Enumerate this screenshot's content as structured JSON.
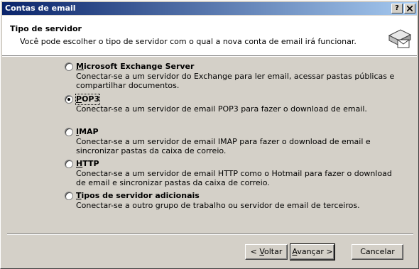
{
  "window": {
    "title": "Contas de email",
    "help_button": "?",
    "close_button": "X"
  },
  "header": {
    "title": "Tipo de servidor",
    "subtitle": "Você pode escolher o tipo de servidor com o qual a nova conta de email irá funcionar."
  },
  "options": [
    {
      "label": "Microsoft Exchange Server",
      "accel": "M",
      "rest": "icrosoft Exchange Server",
      "desc": "Conectar-se a um servidor do Exchange para ler email, acessar pastas públicas e compartilhar documentos.",
      "selected": false
    },
    {
      "label": "POP3",
      "accel": "P",
      "rest": "OP3",
      "desc": "Conectar-se a um servidor de email POP3 para fazer o download de email.",
      "selected": true
    },
    {
      "label": "IMAP",
      "accel": "I",
      "rest": "MAP",
      "desc": "Conectar-se a um servidor de email IMAP para fazer o download de email e sincronizar pastas da caixa de correio.",
      "selected": false
    },
    {
      "label": "HTTP",
      "accel": "H",
      "rest": "TTP",
      "desc": "Conectar-se a um servidor de email HTTP como o Hotmail para fazer o download de email e sincronizar pastas da caixa de correio.",
      "selected": false
    },
    {
      "label": "Tipos de servidor adicionais",
      "accel": "T",
      "rest": "ipos de servidor adicionais",
      "desc": "Conectar-se a outro grupo de trabalho ou servidor de email de terceiros.",
      "selected": false
    }
  ],
  "buttons": {
    "back_prefix": "< ",
    "back_accel": "V",
    "back_rest": "oltar",
    "next_accel": "A",
    "next_rest": "vançar >",
    "cancel": "Cancelar"
  }
}
